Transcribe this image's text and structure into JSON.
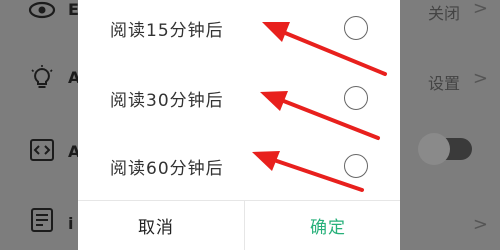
{
  "background": {
    "rows": [
      {
        "icon": "eye-icon",
        "letter": "E",
        "right_text": "关闭"
      },
      {
        "icon": "lightbulb-icon",
        "letter": "A",
        "right_text": "设置"
      },
      {
        "icon": "code-icon",
        "letter": "A",
        "right_text": ""
      },
      {
        "icon": "document-icon",
        "letter": "i",
        "right_text": ""
      }
    ],
    "chevron": ">"
  },
  "dialog": {
    "options": [
      {
        "label": "阅读15分钟后",
        "selected": false
      },
      {
        "label": "阅读30分钟后",
        "selected": false
      },
      {
        "label": "阅读60分钟后",
        "selected": false
      }
    ],
    "cancel_label": "取消",
    "confirm_label": "确定",
    "confirm_color": "#27b07a"
  },
  "annotation": {
    "arrow_color": "#e8201d"
  }
}
